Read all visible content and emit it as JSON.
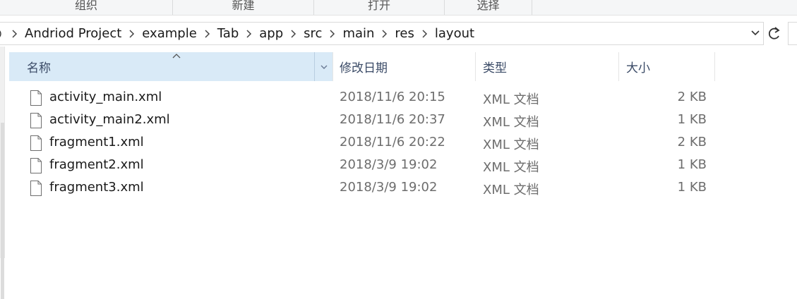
{
  "ribbon": {
    "groups": [
      "组织",
      "新建",
      "打开",
      "选择"
    ]
  },
  "address": {
    "breadcrumbs": [
      "Andriod Project",
      "example",
      "Tab",
      "app",
      "src",
      "main",
      "res",
      "layout"
    ]
  },
  "columns": {
    "name": "名称",
    "date": "修改日期",
    "type": "类型",
    "size": "大小"
  },
  "files": [
    {
      "name": "activity_main.xml",
      "date": "2018/11/6 20:15",
      "type": "XML 文档",
      "size": "2 KB"
    },
    {
      "name": "activity_main2.xml",
      "date": "2018/11/6 20:37",
      "type": "XML 文档",
      "size": "1 KB"
    },
    {
      "name": "fragment1.xml",
      "date": "2018/11/6 20:22",
      "type": "XML 文档",
      "size": "2 KB"
    },
    {
      "name": "fragment2.xml",
      "date": "2018/3/9 19:02",
      "type": "XML 文档",
      "size": "1 KB"
    },
    {
      "name": "fragment3.xml",
      "date": "2018/3/9 19:02",
      "type": "XML 文档",
      "size": "1 KB"
    }
  ],
  "icons": {
    "breadcrumb_separator": "chevron-right-icon",
    "address_dropdown": "chevron-down-icon",
    "refresh": "refresh-icon",
    "file": "document-icon",
    "sort": "sort-ascending-icon"
  },
  "colors": {
    "header_selected_bg": "#d9eaf7",
    "header_text": "#3a4a66",
    "secondary_text": "#6d6d6d"
  }
}
